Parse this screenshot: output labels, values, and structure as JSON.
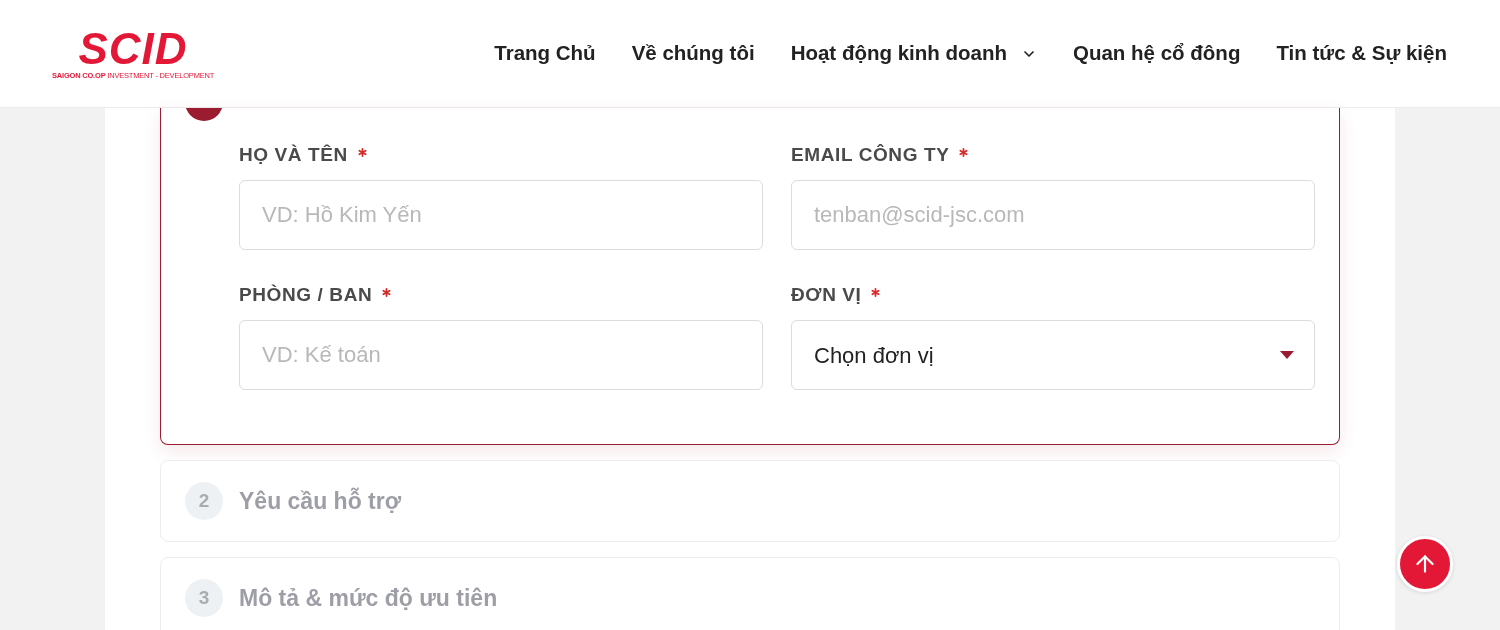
{
  "header": {
    "logo": {
      "name": "SCID",
      "tagline": "**SAIGON CO.OP** INVESTMENT - DEVELOPMENT"
    },
    "nav": [
      {
        "label": "Trang Chủ",
        "dropdown": false
      },
      {
        "label": "Về chúng tôi",
        "dropdown": false
      },
      {
        "label": "Hoạt động kinh doanh",
        "dropdown": true
      },
      {
        "label": "Quan hệ cổ đông",
        "dropdown": false
      },
      {
        "label": "Tin tức & Sự kiện",
        "dropdown": false
      }
    ]
  },
  "steps": [
    {
      "selected": true,
      "fields": [
        {
          "label": "HỌ VÀ TÊN",
          "required": true,
          "kind": "text",
          "placeholder": "VD: Hồ Kim Yến"
        },
        {
          "label": "EMAIL CÔNG TY",
          "required": true,
          "kind": "text",
          "placeholder": "tenban@scid-jsc.com"
        },
        {
          "label": "PHÒNG / BAN",
          "required": true,
          "kind": "text",
          "placeholder": "VD: Kế toán"
        },
        {
          "label": "ĐƠN VỊ",
          "required": true,
          "kind": "select",
          "value": "Chọn đơn vị"
        }
      ]
    },
    {
      "number": "2",
      "title": "Yêu cầu hỗ trợ",
      "selected": false
    },
    {
      "number": "3",
      "title": "Mô tả & mức độ ưu tiên",
      "selected": false
    }
  ]
}
